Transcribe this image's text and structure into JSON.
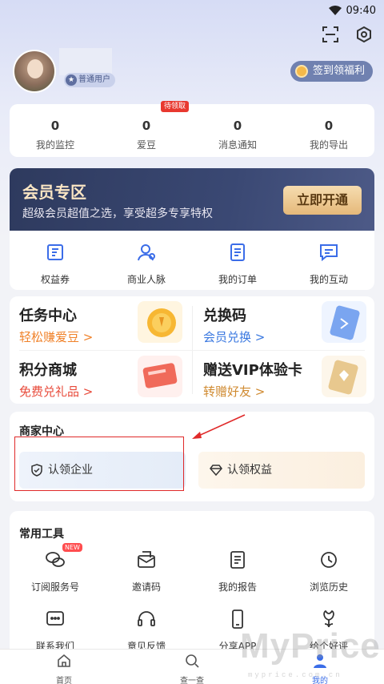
{
  "status": {
    "time": "09:40"
  },
  "profile": {
    "badge": "普通用户",
    "signin": "签到领福利"
  },
  "stats": [
    {
      "num": "0",
      "label": "我的监控"
    },
    {
      "num": "0",
      "label": "爱豆"
    },
    {
      "num": "0",
      "label": "消息通知"
    },
    {
      "num": "0",
      "label": "我的导出"
    }
  ],
  "pending_tag": "待领取",
  "vip": {
    "title": "会员专区",
    "subtitle": "超级会员超值之选，享受超多专享特权",
    "button": "立即开通"
  },
  "quick": [
    {
      "label": "权益券",
      "icon": "coupon-icon"
    },
    {
      "label": "商业人脉",
      "icon": "contacts-icon"
    },
    {
      "label": "我的订单",
      "icon": "order-icon"
    },
    {
      "label": "我的互动",
      "icon": "chat-icon"
    }
  ],
  "tasks": [
    {
      "title": "任务中心",
      "sub": "轻松赚爱豆 >",
      "color": "#f0822a"
    },
    {
      "title": "兑换码",
      "sub": "会员兑换 >",
      "color": "#3a78e0"
    },
    {
      "title": "积分商城",
      "sub": "免费兑礼品 >",
      "color": "#e84a3a"
    },
    {
      "title": "赠送VIP体验卡",
      "sub": "转赠好友 >",
      "color": "#d08a30"
    }
  ],
  "merchant": {
    "title": "商家中心",
    "claim_company": "认领企业",
    "claim_rights": "认领权益"
  },
  "tools": {
    "title": "常用工具",
    "new_tag": "NEW",
    "items": [
      {
        "label": "订阅服务号",
        "icon": "wechat-icon"
      },
      {
        "label": "邀请码",
        "icon": "invite-icon"
      },
      {
        "label": "我的报告",
        "icon": "report-icon"
      },
      {
        "label": "浏览历史",
        "icon": "history-icon"
      },
      {
        "label": "联系我们",
        "icon": "message-icon"
      },
      {
        "label": "意见反馈",
        "icon": "headset-icon"
      },
      {
        "label": "分享APP",
        "icon": "phone-icon"
      },
      {
        "label": "给个好评",
        "icon": "flower-icon"
      }
    ]
  },
  "tabbar": [
    {
      "label": "首页",
      "icon": "home-icon"
    },
    {
      "label": "查一查",
      "icon": "search-icon"
    },
    {
      "label": "我的",
      "icon": "user-icon"
    }
  ],
  "watermark": {
    "text": "MyPrice",
    "sub": "myprice.com.cn"
  },
  "colors": {
    "accent": "#3b6de8",
    "vip_bg": "#2e3a5e",
    "vip_gold": "#e5b97a",
    "alert_red": "#e02a2a"
  }
}
